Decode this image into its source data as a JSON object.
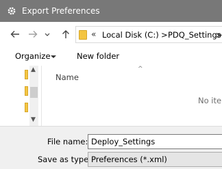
{
  "window": {
    "title": "Export Preferences"
  },
  "address": {
    "overflow": "«",
    "crumbs": [
      "Local Disk (C:)",
      ">",
      "PDQ_Settings",
      ">"
    ]
  },
  "toolbar": {
    "organize_label": "Organize",
    "new_folder_label": "New folder"
  },
  "file_list": {
    "column_name": "Name",
    "empty_message": "No ite"
  },
  "form": {
    "file_name_label": "File name:",
    "file_name_value": "Deploy_Settings",
    "save_type_label": "Save as type:",
    "save_type_value": "Preferences (*.xml)"
  },
  "colors": {
    "titlebar": "#787878",
    "folder": "#f4c542",
    "bottom_panel": "#f0f0f0"
  }
}
